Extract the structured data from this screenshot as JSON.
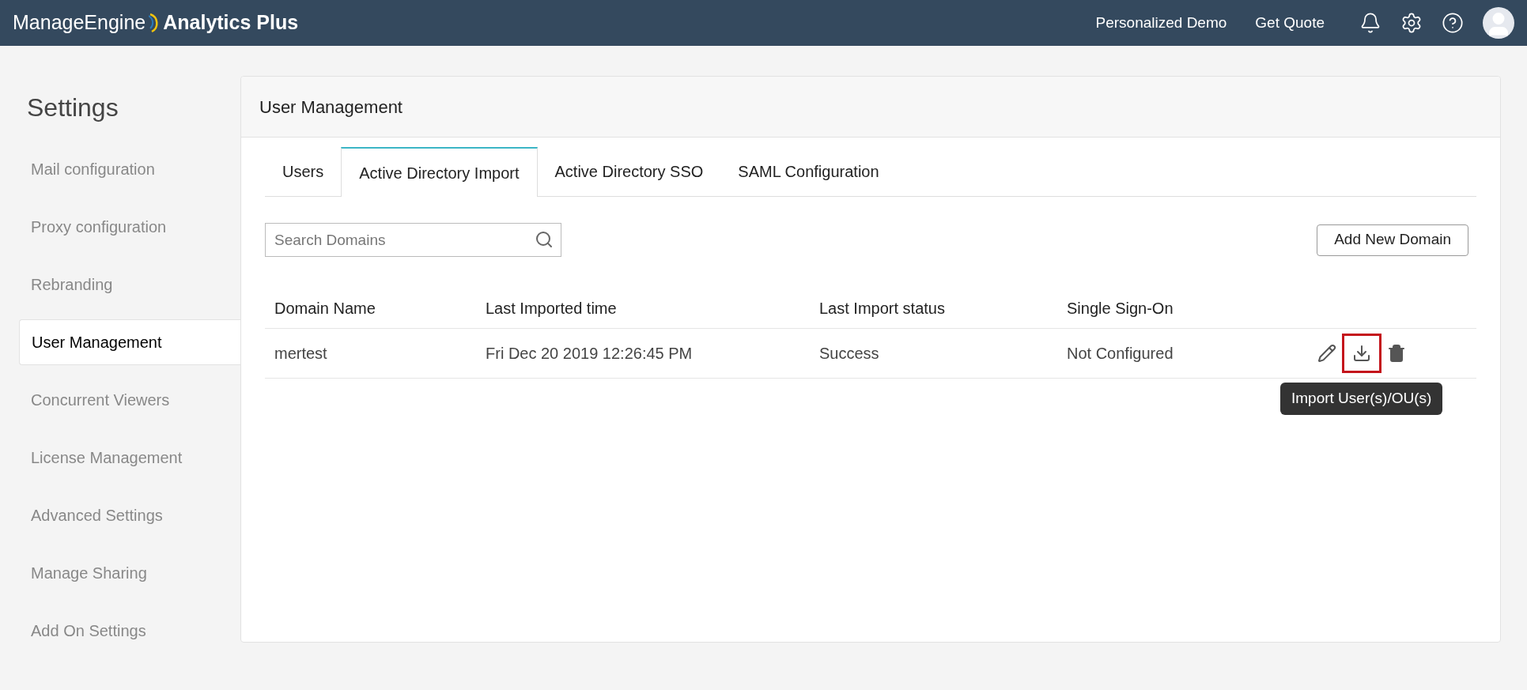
{
  "header": {
    "logo_brand": "ManageEngine",
    "logo_product": "Analytics Plus",
    "links": [
      "Personalized Demo",
      "Get Quote"
    ]
  },
  "sidebar": {
    "title": "Settings",
    "items": [
      {
        "label": "Mail configuration",
        "selected": false
      },
      {
        "label": "Proxy configuration",
        "selected": false
      },
      {
        "label": "Rebranding",
        "selected": false
      },
      {
        "label": "User Management",
        "selected": true
      },
      {
        "label": "Concurrent Viewers",
        "selected": false
      },
      {
        "label": "License Management",
        "selected": false
      },
      {
        "label": "Advanced Settings",
        "selected": false
      },
      {
        "label": "Manage Sharing",
        "selected": false
      },
      {
        "label": "Add On Settings",
        "selected": false
      }
    ]
  },
  "panel": {
    "title": "User Management",
    "tabs": [
      {
        "label": "Users",
        "selected": false
      },
      {
        "label": "Active Directory Import",
        "selected": true
      },
      {
        "label": "Active Directory SSO",
        "selected": false
      },
      {
        "label": "SAML Configuration",
        "selected": false
      }
    ],
    "search": {
      "placeholder": "Search Domains"
    },
    "add_button": "Add New Domain",
    "table": {
      "columns": [
        "Domain Name",
        "Last Imported time",
        "Last Import status",
        "Single Sign-On"
      ],
      "rows": [
        {
          "cells": [
            "mertest",
            "Fri Dec 20 2019 12:26:45 PM",
            "Success",
            "Not Configured"
          ],
          "actions": [
            {
              "kind": "edit",
              "highlighted": false
            },
            {
              "kind": "import",
              "highlighted": true
            },
            {
              "kind": "delete",
              "highlighted": false
            }
          ]
        }
      ]
    },
    "tooltip": "Import User(s)/OU(s)"
  }
}
